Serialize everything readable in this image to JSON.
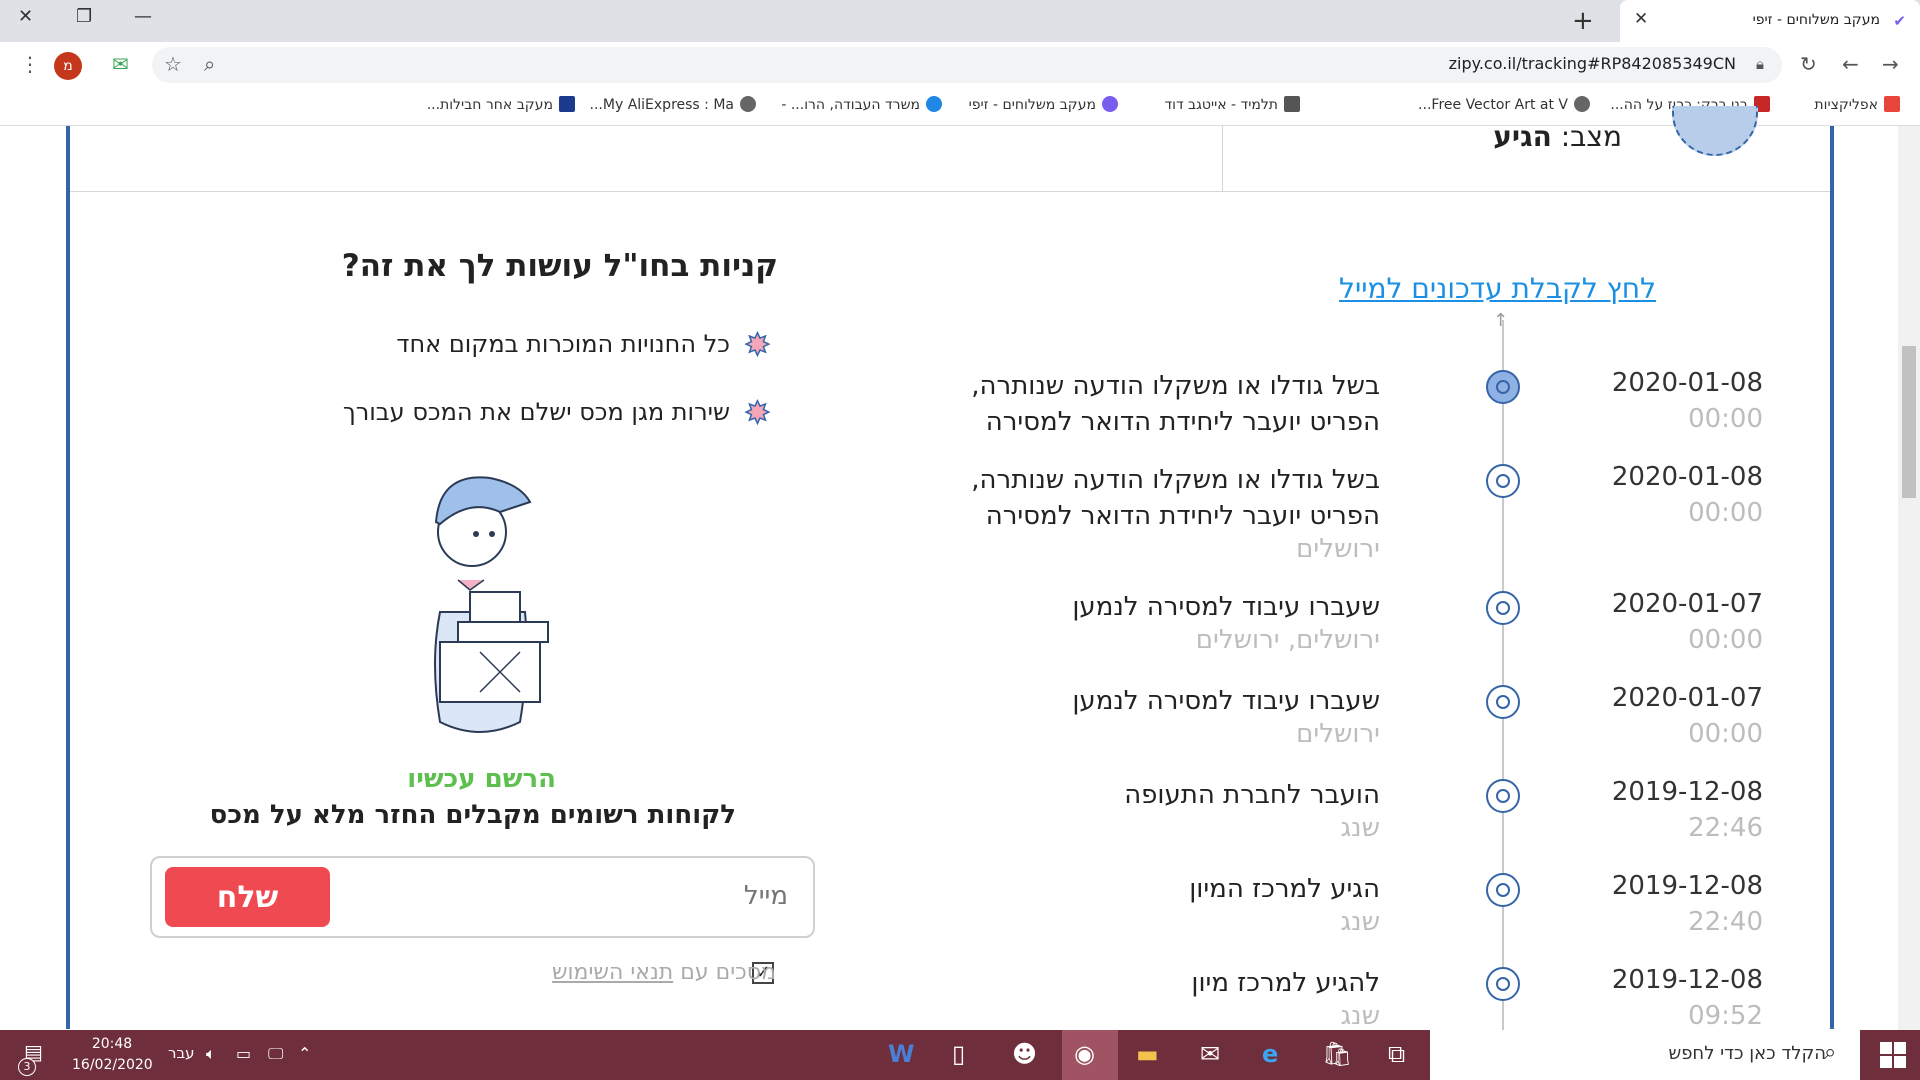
{
  "browser": {
    "tab_title": "מעקב משלוחים - זיפי",
    "url": "zipy.co.il/tracking#RP842085349CN",
    "avatar_letter": "מ",
    "bookmarks": [
      "אפליקציות",
      "בני ברק: כרוז על הה...",
      "Free Vector Art at V...",
      "תלמיד - אייטגב דוד",
      "מעקב משלוחים - זיפי",
      "משרד העבודה, הרו... -",
      "My AliExpress : Ma...",
      "מעקב אחר חבילות..."
    ]
  },
  "status": {
    "label": "מצב:",
    "value": "הגיע"
  },
  "tracking": {
    "email_link": "לחץ לקבלת עדכונים למייל",
    "events": [
      {
        "date": "2020-01-08",
        "time": "00:00",
        "desc": "בשל גודלו או משקלו הודעה שנותרה, הפריט יועבר ליחידת הדואר למסירה",
        "loc": "",
        "active": true
      },
      {
        "date": "2020-01-08",
        "time": "00:00",
        "desc": "בשל גודלו או משקלו הודעה שנותרה, הפריט יועבר ליחידת הדואר למסירה",
        "loc": "ירושלים",
        "active": false
      },
      {
        "date": "2020-01-07",
        "time": "00:00",
        "desc": "שעברו עיבוד למסירה לנמען",
        "loc": "ירושלים, ירושלים",
        "active": false
      },
      {
        "date": "2020-01-07",
        "time": "00:00",
        "desc": "שעברו עיבוד למסירה לנמען",
        "loc": "ירושלים",
        "active": false
      },
      {
        "date": "2019-12-08",
        "time": "22:46",
        "desc": "הועבר לחברת התעופה",
        "loc": "שנג",
        "active": false
      },
      {
        "date": "2019-12-08",
        "time": "22:40",
        "desc": "הגיע למרכז המיון",
        "loc": "שנג",
        "active": false
      },
      {
        "date": "2019-12-08",
        "time": "09:52",
        "desc": "להגיע למרכז מיון",
        "loc": "שנג",
        "active": false
      }
    ]
  },
  "promo": {
    "title": "קניות בחו\"ל עושות לך את זה?",
    "items": [
      "כל החנויות המוכרות במקום אחד",
      "שירות מגן מכס ישלם את המכס עבורך"
    ],
    "register_now": "הרשם עכשיו",
    "register_sub": "לקוחות רשומים מקבלים החזר מלא על מכס",
    "email_placeholder": "מייל",
    "send_label": "שלח",
    "agree_prefix": "מסכים עם",
    "agree_link": "תנאי השימוש"
  },
  "taskbar": {
    "search_placeholder": "הקלד כאן כדי לחפש",
    "time": "20:48",
    "date": "16/02/2020",
    "lang": "עבר",
    "notif_count": "3"
  }
}
